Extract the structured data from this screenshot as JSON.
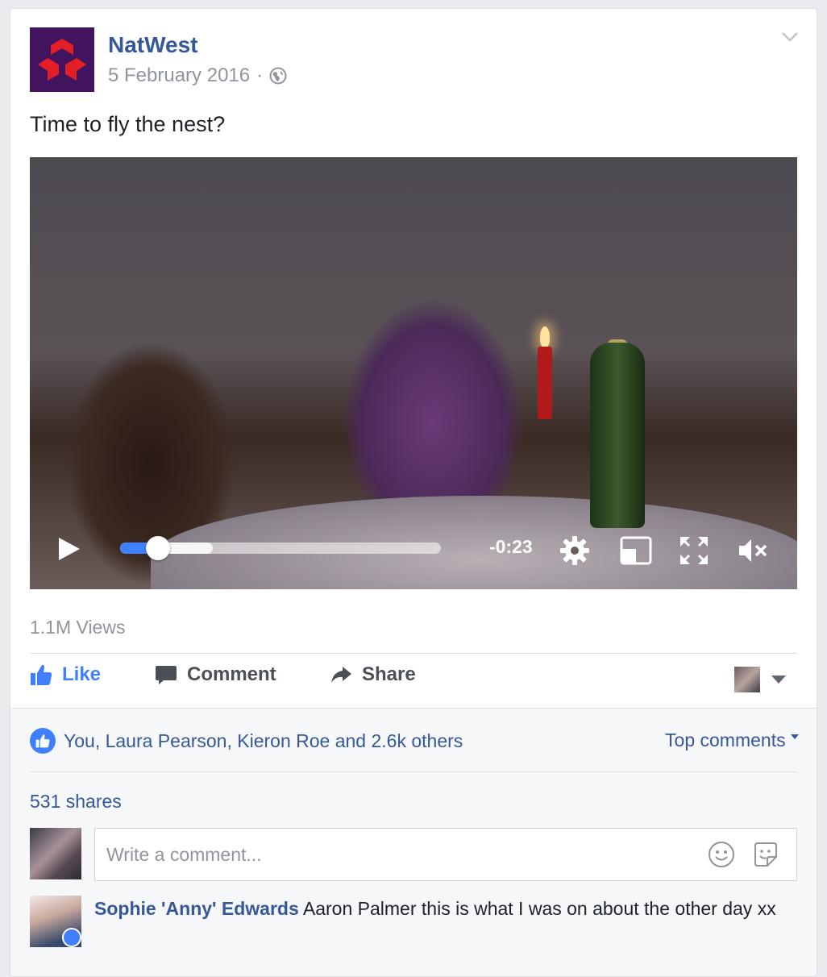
{
  "post": {
    "page_name": "NatWest",
    "date": "5 February 2016",
    "separator": "·",
    "text": "Time to fly the nest?"
  },
  "video": {
    "time_remaining": "-0:23",
    "progress_fraction": 0.08,
    "buffered_fraction": 0.29,
    "state": "paused",
    "muted": true
  },
  "stats": {
    "views": "1.1M Views"
  },
  "actions": {
    "like_label": "Like",
    "comment_label": "Comment",
    "share_label": "Share"
  },
  "footer": {
    "reactions_text": "You, Laura Pearson, Kieron Roe and 2.6k others",
    "top_comments_label": "Top comments",
    "shares_text": "531 shares",
    "comment_placeholder": "Write a comment..."
  },
  "comment": {
    "author": "Sophie 'Anny' Edwards",
    "text": "Aaron Palmer this is what I was on about the other day xx"
  },
  "colors": {
    "brand_blue": "#365899",
    "like_blue": "#4080ff",
    "natwest_purple": "#42145f",
    "natwest_red": "#e31e24"
  },
  "icons": [
    "natwest-logo",
    "chevron-down-icon",
    "globe-icon",
    "play-icon",
    "settings-icon",
    "pip-icon",
    "fullscreen-icon",
    "mute-icon",
    "like-icon",
    "comment-icon",
    "share-icon",
    "caret-down-icon",
    "smiley-icon",
    "sticker-icon"
  ]
}
